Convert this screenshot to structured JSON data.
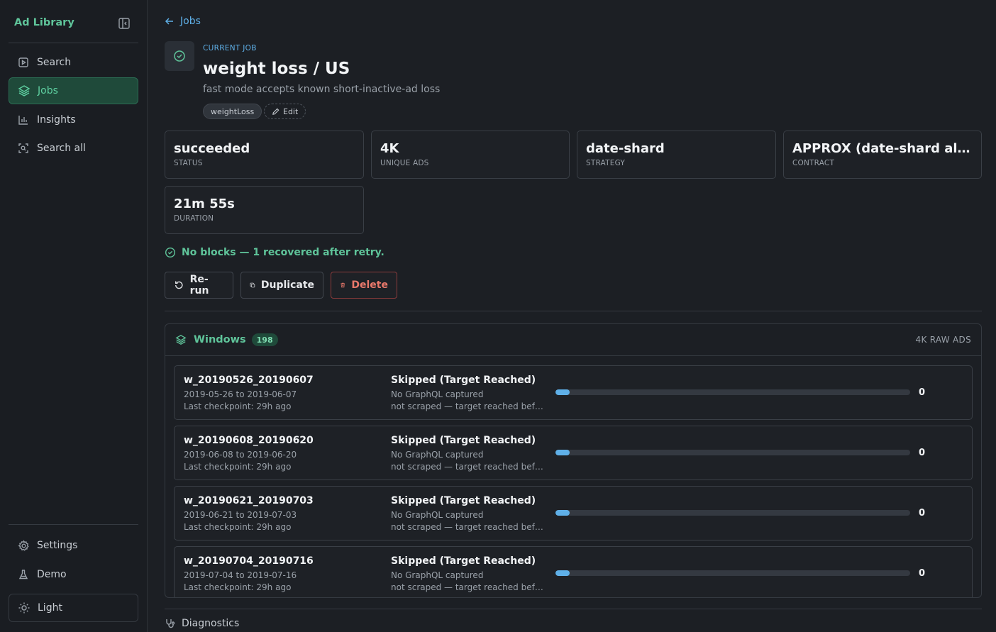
{
  "sidebar": {
    "brand": "Ad Library",
    "items": [
      {
        "label": "Search"
      },
      {
        "label": "Jobs"
      },
      {
        "label": "Insights"
      },
      {
        "label": "Search all"
      }
    ],
    "bottom_items": [
      {
        "label": "Settings"
      },
      {
        "label": "Demo"
      }
    ],
    "theme_toggle": "Light"
  },
  "header": {
    "back_label": "Jobs",
    "eyebrow": "CURRENT JOB",
    "title": "weight loss / US",
    "subtitle": "fast mode accepts known short-inactive-ad loss",
    "tag": "weightLoss",
    "edit_label": "Edit"
  },
  "stats": [
    {
      "value": "succeeded",
      "label": "STATUS"
    },
    {
      "value": "4K",
      "label": "UNIQUE ADS"
    },
    {
      "value": "date-shard",
      "label": "STRATEGY"
    },
    {
      "value": "APPROX (date-shard all-st...",
      "label": "CONTRACT"
    },
    {
      "value": "21m 55s",
      "label": "DURATION"
    }
  ],
  "health": "No blocks — 1 recovered after retry.",
  "actions": {
    "rerun": "Re-run",
    "duplicate": "Duplicate",
    "delete": "Delete"
  },
  "windows": {
    "title": "Windows",
    "count": "198",
    "raw": "4K RAW ADS",
    "rows": [
      {
        "id": "w_20190526_20190607",
        "range": "2019-05-26 to 2019-06-07",
        "checkpoint": "Last checkpoint: 29h ago",
        "status": "Skipped (Target Reached)",
        "gql": "No GraphQL captured",
        "note": "not scraped — target reached before ...",
        "progress": 0.04,
        "count": "0"
      },
      {
        "id": "w_20190608_20190620",
        "range": "2019-06-08 to 2019-06-20",
        "checkpoint": "Last checkpoint: 29h ago",
        "status": "Skipped (Target Reached)",
        "gql": "No GraphQL captured",
        "note": "not scraped — target reached before ...",
        "progress": 0.04,
        "count": "0"
      },
      {
        "id": "w_20190621_20190703",
        "range": "2019-06-21 to 2019-07-03",
        "checkpoint": "Last checkpoint: 29h ago",
        "status": "Skipped (Target Reached)",
        "gql": "No GraphQL captured",
        "note": "not scraped — target reached before ...",
        "progress": 0.04,
        "count": "0"
      },
      {
        "id": "w_20190704_20190716",
        "range": "2019-07-04 to 2019-07-16",
        "checkpoint": "Last checkpoint: 29h ago",
        "status": "Skipped (Target Reached)",
        "gql": "No GraphQL captured",
        "note": "not scraped — target reached before ...",
        "progress": 0.04,
        "count": "0"
      }
    ]
  },
  "diagnostics": "Diagnostics",
  "colors": {
    "accent_green": "#5fc49a",
    "accent_blue": "#5fb0e8",
    "danger": "#e8786b",
    "background": "#1c1f24"
  }
}
